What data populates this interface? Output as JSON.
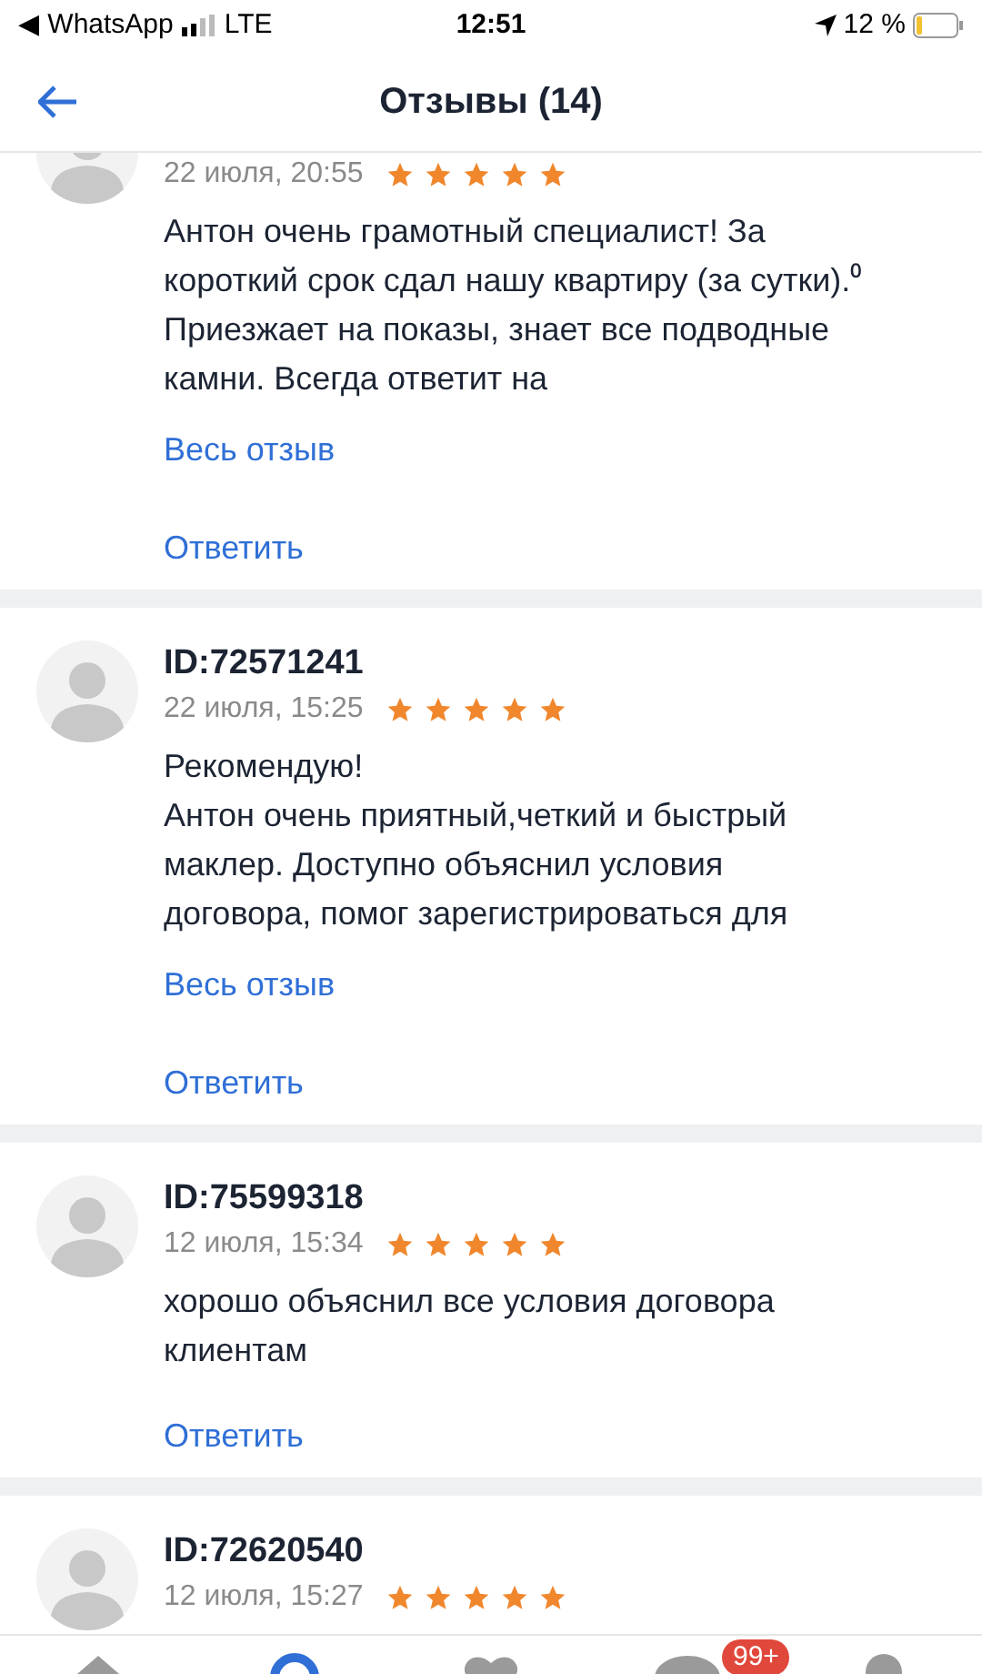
{
  "status_bar": {
    "back_app": "◀ WhatsApp",
    "network": "LTE",
    "time": "12:51",
    "battery": "12 %"
  },
  "header": {
    "title": "Отзывы (14)"
  },
  "reviews": [
    {
      "date": "22 июля, 20:55",
      "stars": 5,
      "text": "Антон очень грамотный специалист! За короткий срок сдал нашу квартиру (за сутки).⁰ Приезжает на показы, знает все подводные камни. Всегда ответит на",
      "more": "Весь отзыв",
      "reply": "Ответить"
    },
    {
      "id": "ID:72571241",
      "date": "22 июля, 15:25",
      "stars": 5,
      "text": "Рекомендую!\nАнтон очень приятный,четкий и быстрый маклер. Доступно объяснил условия договора, помог зарегистрироваться для",
      "more": "Весь отзыв",
      "reply": "Ответить"
    },
    {
      "id": "ID:75599318",
      "date": "12 июля, 15:34",
      "stars": 5,
      "text": "хорошо объяснил все условия договора клиентам",
      "reply": "Ответить"
    },
    {
      "id": "ID:72620540",
      "date": "12 июля, 15:27",
      "stars": 5
    }
  ],
  "tab_bar": [
    {
      "kind": "home",
      "selected": false
    },
    {
      "kind": "search",
      "selected": true
    },
    {
      "kind": "heart",
      "selected": false
    },
    {
      "kind": "chat",
      "selected": false,
      "badge": "99+"
    },
    {
      "kind": "profile",
      "selected": false
    }
  ]
}
